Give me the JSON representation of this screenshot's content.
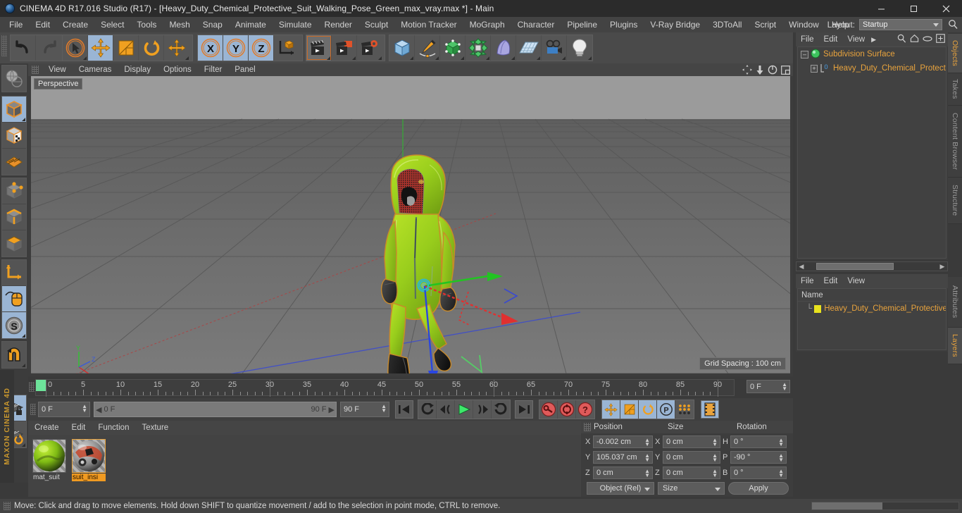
{
  "window": {
    "title": "CINEMA 4D R17.016 Studio (R17) - [Heavy_Duty_Chemical_Protective_Suit_Walking_Pose_Green_max_vray.max *] - Main",
    "minimize": "—",
    "maximize": "❐",
    "close": "✕"
  },
  "menubar": {
    "items": [
      {
        "label": "File"
      },
      {
        "label": "Edit"
      },
      {
        "label": "Create"
      },
      {
        "label": "Select"
      },
      {
        "label": "Tools"
      },
      {
        "label": "Mesh"
      },
      {
        "label": "Snap"
      },
      {
        "label": "Animate"
      },
      {
        "label": "Simulate"
      },
      {
        "label": "Render"
      },
      {
        "label": "Sculpt"
      },
      {
        "label": "Motion Tracker"
      },
      {
        "label": "MoGraph"
      },
      {
        "label": "Character"
      },
      {
        "label": "Pipeline"
      },
      {
        "label": "Plugins"
      },
      {
        "label": "V-Ray Bridge"
      },
      {
        "label": "3DToAll"
      },
      {
        "label": "Script"
      },
      {
        "label": "Window"
      },
      {
        "label": "Help"
      }
    ],
    "layout_label": "Layout:",
    "layout_value": "Startup"
  },
  "toolbar": {
    "undo": "undo-icon",
    "redo": "redo-icon",
    "live_selection": "live-selection-icon",
    "move": "move-tool-icon",
    "scale": "scale-tool-icon",
    "rotate": "rotate-tool-icon",
    "move_alt": "move-alt-icon",
    "axis_x": "X",
    "axis_y": "Y",
    "axis_z": "Z",
    "world_axis": "world-coordinate-icon",
    "render_view": "render-view-icon",
    "render_region": "render-region-icon",
    "render_settings": "render-settings-icon",
    "cube": "cube-primitive-icon",
    "spline": "spline-pen-icon",
    "nurbs": "generator-icon",
    "array": "deformer-icon",
    "scene_object": "scene-object-icon",
    "floor": "environment-icon",
    "camera": "camera-icon",
    "light": "light-icon"
  },
  "lefttoolbar": {
    "items": [
      {
        "name": "texture-axis-icon",
        "selected": false
      },
      {
        "name": "model-mode-icon",
        "selected": true
      },
      {
        "name": "texture-mode-icon",
        "selected": false
      },
      {
        "name": "polygon-mode-icon",
        "selected": false
      },
      {
        "name": "point-mode-icon",
        "selected": false
      },
      {
        "name": "edge-mode-icon",
        "selected": false
      },
      {
        "name": "polygon-face-icon",
        "selected": false
      },
      {
        "name": "axis-modify-icon",
        "selected": false
      },
      {
        "name": "enable-axis-icon",
        "selected": true
      },
      {
        "name": "soft-selection-icon",
        "selected": true
      },
      {
        "name": "snap-magnet-icon",
        "selected": false
      },
      {
        "name": "workplane-lock-icon",
        "selected": true
      },
      {
        "name": "workplane-rotate-icon",
        "selected": false
      }
    ],
    "brand": "MAXON CINEMA 4D"
  },
  "viewport": {
    "menu": [
      {
        "label": "View"
      },
      {
        "label": "Cameras"
      },
      {
        "label": "Display"
      },
      {
        "label": "Options"
      },
      {
        "label": "Filter"
      },
      {
        "label": "Panel"
      }
    ],
    "view_name": "Perspective",
    "grid_spacing": "Grid Spacing : 100 cm"
  },
  "timeline": {
    "tick_labels": [
      "0",
      "5",
      "10",
      "15",
      "20",
      "25",
      "30",
      "35",
      "40",
      "45",
      "50",
      "55",
      "60",
      "65",
      "70",
      "75",
      "80",
      "85",
      "90"
    ],
    "range_start": 0,
    "range_end": 90,
    "current_frame_field": "0 F"
  },
  "playback": {
    "current_frame": "0 F",
    "preview_start": "0 F",
    "preview_end": "90 F",
    "doc_end": "90 F",
    "buttons": {
      "go_start": "go-to-start-icon",
      "prev_key": "previous-keyframe-icon",
      "prev_frame": "previous-frame-icon",
      "play": "play-icon",
      "next_frame": "next-frame-icon",
      "next_key": "next-keyframe-icon",
      "go_end": "go-to-end-icon",
      "record": "record-keyframe-icon",
      "autokey": "autokeying-icon",
      "keyframe_select": "keyframe-selection-icon",
      "key_pos": "key-position-icon",
      "key_scale": "key-scale-icon",
      "key_rot": "key-rotation-icon",
      "key_param": "P",
      "key_pla": "point-level-animation-icon",
      "timeline_toggle": "timeline-toggle-icon"
    }
  },
  "materials": {
    "menu": [
      {
        "label": "Create"
      },
      {
        "label": "Edit"
      },
      {
        "label": "Function"
      },
      {
        "label": "Texture"
      }
    ],
    "items": [
      {
        "name": "mat_suit",
        "selected": false
      },
      {
        "name": "suit_insi",
        "selected": true
      }
    ]
  },
  "coordinates": {
    "headers": [
      "Position",
      "Size",
      "Rotation"
    ],
    "rows": [
      {
        "a1": "X",
        "v1": "-0.002 cm",
        "a2": "X",
        "v2": "0 cm",
        "a3": "H",
        "v3": "0 °"
      },
      {
        "a1": "Y",
        "v1": "105.037 cm",
        "a2": "Y",
        "v2": "0 cm",
        "a3": "P",
        "v3": "-90 °"
      },
      {
        "a1": "Z",
        "v1": "0 cm",
        "a2": "Z",
        "v2": "0 cm",
        "a3": "B",
        "v3": "0 °"
      }
    ],
    "mode_left": "Object (Rel)",
    "mode_mid": "Size",
    "apply": "Apply"
  },
  "object_manager": {
    "menu": [
      {
        "label": "File"
      },
      {
        "label": "Edit"
      },
      {
        "label": "View"
      }
    ],
    "rows": [
      {
        "label": "Subdivision Surface",
        "indent": 0,
        "icon": "subdivision-surface-icon"
      },
      {
        "label": "Heavy_Duty_Chemical_Protective_",
        "indent": 1,
        "icon": "null-object-icon"
      }
    ]
  },
  "layer_manager": {
    "menu": [
      {
        "label": "File"
      },
      {
        "label": "Edit"
      },
      {
        "label": "View"
      }
    ],
    "column_header": "Name",
    "rows": [
      {
        "label": "Heavy_Duty_Chemical_Protective_S",
        "color": "#e8e21e"
      }
    ]
  },
  "right_tabs_top": [
    {
      "label": "Objects",
      "active": true
    },
    {
      "label": "Takes",
      "active": false
    },
    {
      "label": "Content Browser",
      "active": false
    },
    {
      "label": "Structure",
      "active": false
    }
  ],
  "right_tabs_bottom": [
    {
      "label": "Attributes",
      "active": false
    },
    {
      "label": "Layers",
      "active": true
    }
  ],
  "statusbar": {
    "message": "Move: Click and drag to move elements. Hold down SHIFT to quantize movement / add to the selection in point mode, CTRL to remove."
  },
  "colors": {
    "accent_orange": "#e8a33d",
    "selection_blue": "#9ab5d4",
    "suit_green": "#9ad122",
    "axis_x": "#e03030",
    "axis_y": "#22c422",
    "axis_z": "#2a46e0"
  }
}
